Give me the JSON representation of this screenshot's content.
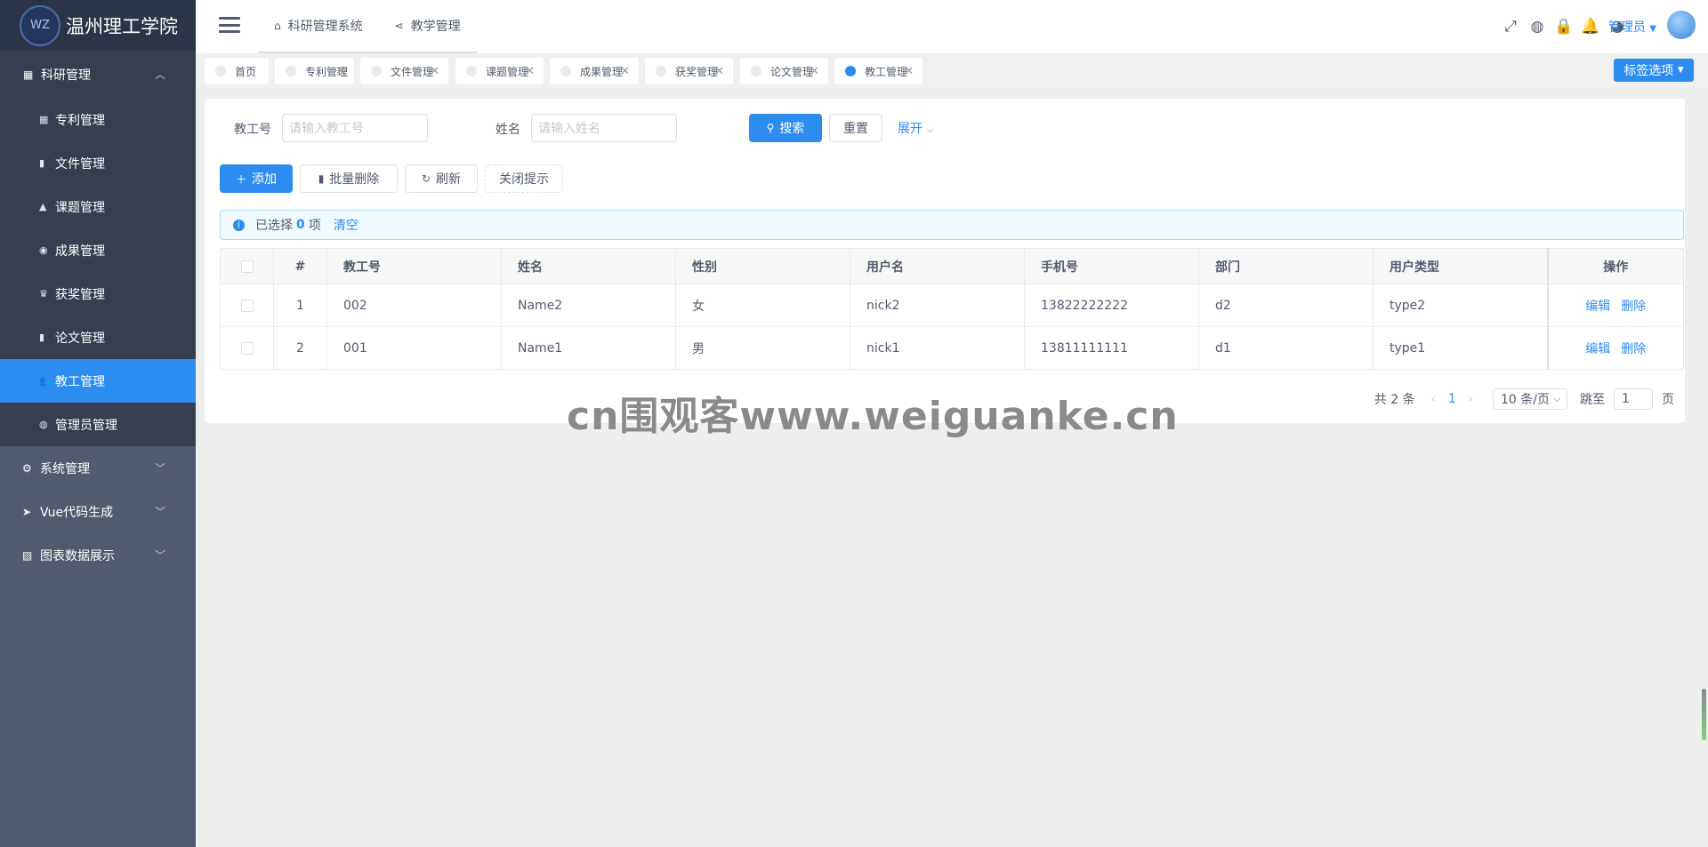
{
  "logo": {
    "title": "温州理工学院",
    "mark": "WZ"
  },
  "sidebar": {
    "group": {
      "title": "科研管理",
      "items": [
        {
          "label": "专利管理",
          "icon": "patent-icon",
          "glyph": "▦"
        },
        {
          "label": "文件管理",
          "icon": "file-icon",
          "glyph": "▮"
        },
        {
          "label": "课题管理",
          "icon": "flask-icon",
          "glyph": "▲"
        },
        {
          "label": "成果管理",
          "icon": "circle-icon",
          "glyph": "◉"
        },
        {
          "label": "获奖管理",
          "icon": "trophy-icon",
          "glyph": "♛"
        },
        {
          "label": "论文管理",
          "icon": "book-icon",
          "glyph": "▮"
        },
        {
          "label": "教工管理",
          "icon": "people-icon",
          "glyph": "👥"
        },
        {
          "label": "管理员管理",
          "icon": "admin-icon",
          "glyph": "◍"
        }
      ]
    },
    "menus": [
      {
        "label": "系统管理",
        "icon": "gear-icon",
        "glyph": "⚙"
      },
      {
        "label": "Vue代码生成",
        "icon": "send-icon",
        "glyph": "➤"
      },
      {
        "label": "图表数据展示",
        "icon": "chart-icon",
        "glyph": "▧"
      }
    ]
  },
  "header": {
    "nav": [
      {
        "label": "科研管理系统",
        "icon": "home-icon",
        "glyph": "⌂"
      },
      {
        "label": "教学管理",
        "icon": "share-icon",
        "glyph": "⋖"
      }
    ],
    "icons": [
      {
        "name": "fullscreen-icon",
        "glyph": "⤢"
      },
      {
        "name": "globe-icon",
        "glyph": "◍"
      },
      {
        "name": "lock-icon",
        "glyph": "🔒"
      },
      {
        "name": "bell-icon",
        "glyph": "🔔"
      },
      {
        "name": "github-icon",
        "glyph": "◕"
      }
    ],
    "user": "管理员"
  },
  "tabs": [
    {
      "label": "首页",
      "closable": false,
      "active": false
    },
    {
      "label": "专利管理",
      "closable": true,
      "active": false
    },
    {
      "label": "文件管理",
      "closable": true,
      "active": false
    },
    {
      "label": "课题管理",
      "closable": true,
      "active": false
    },
    {
      "label": "成果管理",
      "closable": true,
      "active": false
    },
    {
      "label": "获奖管理",
      "closable": true,
      "active": false
    },
    {
      "label": "论文管理",
      "closable": true,
      "active": false
    },
    {
      "label": "教工管理",
      "closable": true,
      "active": true
    }
  ],
  "tab_options": "标签选项",
  "search": {
    "staff_no_label": "教工号",
    "staff_no_placeholder": "请输入教工号",
    "name_label": "姓名",
    "name_placeholder": "请输入姓名",
    "search_btn": "搜索",
    "reset_btn": "重置",
    "expand": "展开"
  },
  "toolbar": {
    "add": "添加",
    "batch_delete": "批量删除",
    "refresh": "刷新",
    "close_tip": "关闭提示"
  },
  "alert": {
    "prefix": "已选择",
    "count": "0",
    "suffix": "项",
    "clear": "清空"
  },
  "table": {
    "headers": [
      "#",
      "教工号",
      "姓名",
      "性别",
      "用户名",
      "手机号",
      "部门",
      "用户类型",
      "操作"
    ],
    "rows": [
      {
        "idx": "1",
        "no": "002",
        "name": "Name2",
        "sex": "女",
        "username": "nick2",
        "phone": "13822222222",
        "dept": "d2",
        "type": "type2"
      },
      {
        "idx": "2",
        "no": "001",
        "name": "Name1",
        "sex": "男",
        "username": "nick1",
        "phone": "13811111111",
        "dept": "d1",
        "type": "type1"
      }
    ],
    "edit": "编辑",
    "delete": "删除"
  },
  "pager": {
    "total": "共 2 条",
    "page": "1",
    "page_size": "10 条/页",
    "jump_label": "跳至",
    "jump_value": "1",
    "page_suffix": "页"
  },
  "watermark": "cn围观客www.weiguanke.cn",
  "colors": {
    "primary": "#2d8cf0",
    "sidebar": "#515a6e",
    "sidebar_dark": "#363e4f"
  }
}
